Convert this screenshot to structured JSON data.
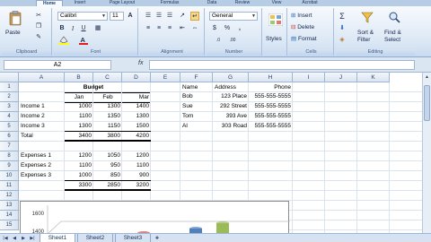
{
  "ribbon": {
    "tabs": [
      "Home",
      "Insert",
      "Page Layout",
      "Formulas",
      "Data",
      "Review",
      "View",
      "Acrobat"
    ],
    "active_tab": "Home",
    "clipboard": {
      "paste_label": "Paste",
      "group_label": "Clipboard"
    },
    "font": {
      "font_name": "Calibri",
      "font_size": "11",
      "group_label": "Font"
    },
    "alignment": {
      "group_label": "Alignment"
    },
    "number": {
      "format": "General",
      "currency": "$",
      "percent": "%",
      "comma": ",",
      "group_label": "Number"
    },
    "styles": {
      "label": "Styles"
    },
    "cells": {
      "insert": "Insert",
      "delete": "Delete",
      "format": "Format",
      "group_label": "Cells"
    },
    "editing": {
      "sum": "Σ",
      "sort_filter": "Sort &\nFilter",
      "sort_label": "Sort &",
      "filter_label": "Filter",
      "find_label": "Find &",
      "select_label": "Select",
      "group_label": "Editing"
    }
  },
  "formula_bar": {
    "name_box": "A2",
    "fx": "fx",
    "value": ""
  },
  "columns": [
    "A",
    "B",
    "C",
    "D",
    "E",
    "F",
    "G",
    "H",
    "I",
    "J",
    "K"
  ],
  "rows": [
    "1",
    "2",
    "3",
    "4",
    "5",
    "6",
    "7",
    "8",
    "9",
    "10",
    "11",
    "12",
    "13",
    "14",
    "15"
  ],
  "budget": {
    "title": "Budget",
    "months": [
      "Jan",
      "Feb",
      "Mar"
    ],
    "income": [
      {
        "label": "Income 1",
        "values": [
          "1000",
          "1300",
          "1400"
        ]
      },
      {
        "label": "Income 2",
        "values": [
          "1100",
          "1350",
          "1300"
        ]
      },
      {
        "label": "Income 3",
        "values": [
          "1300",
          "1150",
          "1500"
        ]
      }
    ],
    "total_label": "Total",
    "income_total": [
      "3400",
      "3800",
      "4200"
    ],
    "expenses": [
      {
        "label": "Expenses 1",
        "values": [
          "1200",
          "1050",
          "1200"
        ]
      },
      {
        "label": "Expenses 2",
        "values": [
          "1100",
          "950",
          "1100"
        ]
      },
      {
        "label": "Expenses 3",
        "values": [
          "1000",
          "850",
          "900"
        ]
      }
    ],
    "expense_total": [
      "3300",
      "2850",
      "3200"
    ]
  },
  "contacts": {
    "headers": [
      "Name",
      "Address",
      "Phone"
    ],
    "rows": [
      {
        "name": "Bob",
        "address": "123 Place",
        "phone": "555-555-5555"
      },
      {
        "name": "Sue",
        "address": "292 Street",
        "phone": "555-555-5555"
      },
      {
        "name": "Tom",
        "address": "393 Ave",
        "phone": "555-555-5555"
      },
      {
        "name": "Al",
        "address": "303 Road",
        "phone": "555-555-5555"
      }
    ]
  },
  "chart_data": {
    "type": "bar",
    "ytick_labels": [
      "1600",
      "1400"
    ],
    "bar_colors": [
      "#c0504d",
      "#4f81bd",
      "#9bbb59"
    ]
  },
  "sheets": [
    "Sheet1",
    "Sheet2",
    "Sheet3"
  ],
  "active_sheet": "Sheet1"
}
